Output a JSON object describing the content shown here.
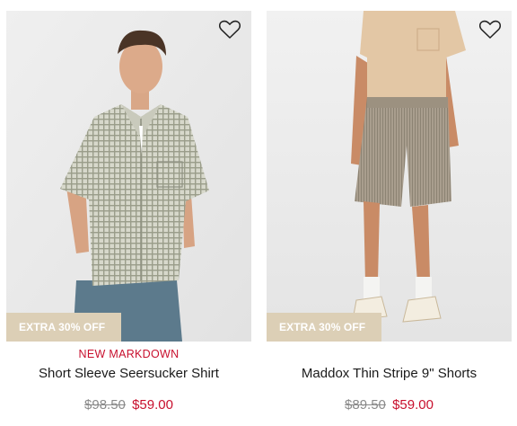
{
  "products": [
    {
      "image_alt": "model wearing short sleeve seersucker shirt and blue trousers",
      "wishlist_icon": "heart-outline-icon",
      "promo_badge": "EXTRA 30% OFF",
      "flag": "NEW MARKDOWN",
      "name": "Short Sleeve Seersucker Shirt",
      "original_price": "$98.50",
      "sale_price": "$59.00"
    },
    {
      "image_alt": "model wearing tan t-shirt and thin stripe shorts",
      "wishlist_icon": "heart-outline-icon",
      "promo_badge": "EXTRA 30% OFF",
      "flag": "",
      "name": "Maddox Thin Stripe 9\" Shorts",
      "original_price": "$89.50",
      "sale_price": "$59.00"
    }
  ],
  "colors": {
    "sale_red": "#c8102e",
    "promo_badge_bg": "#dccfb6",
    "image_bg": "#ebebeb"
  }
}
